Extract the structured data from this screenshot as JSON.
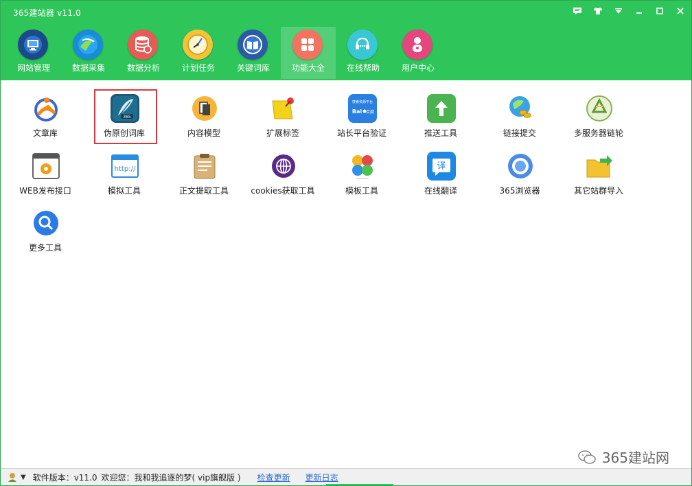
{
  "window": {
    "title": "365建站器 v11.0"
  },
  "toolbar": {
    "items": [
      {
        "label": "网站管理",
        "icon": "monitor-icon"
      },
      {
        "label": "数据采集",
        "icon": "globe-swirl-icon"
      },
      {
        "label": "数据分析",
        "icon": "database-icon"
      },
      {
        "label": "计划任务",
        "icon": "clock-icon"
      },
      {
        "label": "关键词库",
        "icon": "book-icon"
      },
      {
        "label": "功能大全",
        "icon": "apps-grid-icon"
      },
      {
        "label": "在线帮助",
        "icon": "headset-icon"
      },
      {
        "label": "用户中心",
        "icon": "user-icon"
      }
    ],
    "active_index": 5
  },
  "tools": {
    "row1": [
      {
        "label": "文章库"
      },
      {
        "label": "伪原创词库"
      },
      {
        "label": "内容模型"
      },
      {
        "label": "扩展标签"
      },
      {
        "label": "站长平台验证",
        "icon_text_top": "搜索资源平台",
        "icon_text_brand": "Bai",
        "icon_text_brand2": "百度"
      },
      {
        "label": "推送工具"
      },
      {
        "label": "链接提交"
      },
      {
        "label": "多服务器链轮"
      }
    ],
    "row2": [
      {
        "label": "WEB发布接口"
      },
      {
        "label": "模拟工具",
        "icon_text": "http://"
      },
      {
        "label": "正文提取工具"
      },
      {
        "label": "cookies获取工具"
      },
      {
        "label": "模板工具"
      },
      {
        "label": "在线翻译",
        "icon_text": "译"
      },
      {
        "label": "365浏览器"
      },
      {
        "label": "其它站群导入"
      }
    ],
    "row3": [
      {
        "label": "更多工具"
      }
    ],
    "selected": "伪原创词库",
    "pen_badge": "365"
  },
  "watermark": {
    "text": "365建站网"
  },
  "status": {
    "version_text": "软件版本：v11.0",
    "welcome_text": "欢迎您：我和我追逐的梦( vip旗舰版 )",
    "check_update": "检查更新",
    "update_log": "更新日志"
  },
  "colors": {
    "brand_green": "#2ec55a",
    "highlight_red": "#d9393e",
    "link_blue": "#2b6dd7"
  }
}
